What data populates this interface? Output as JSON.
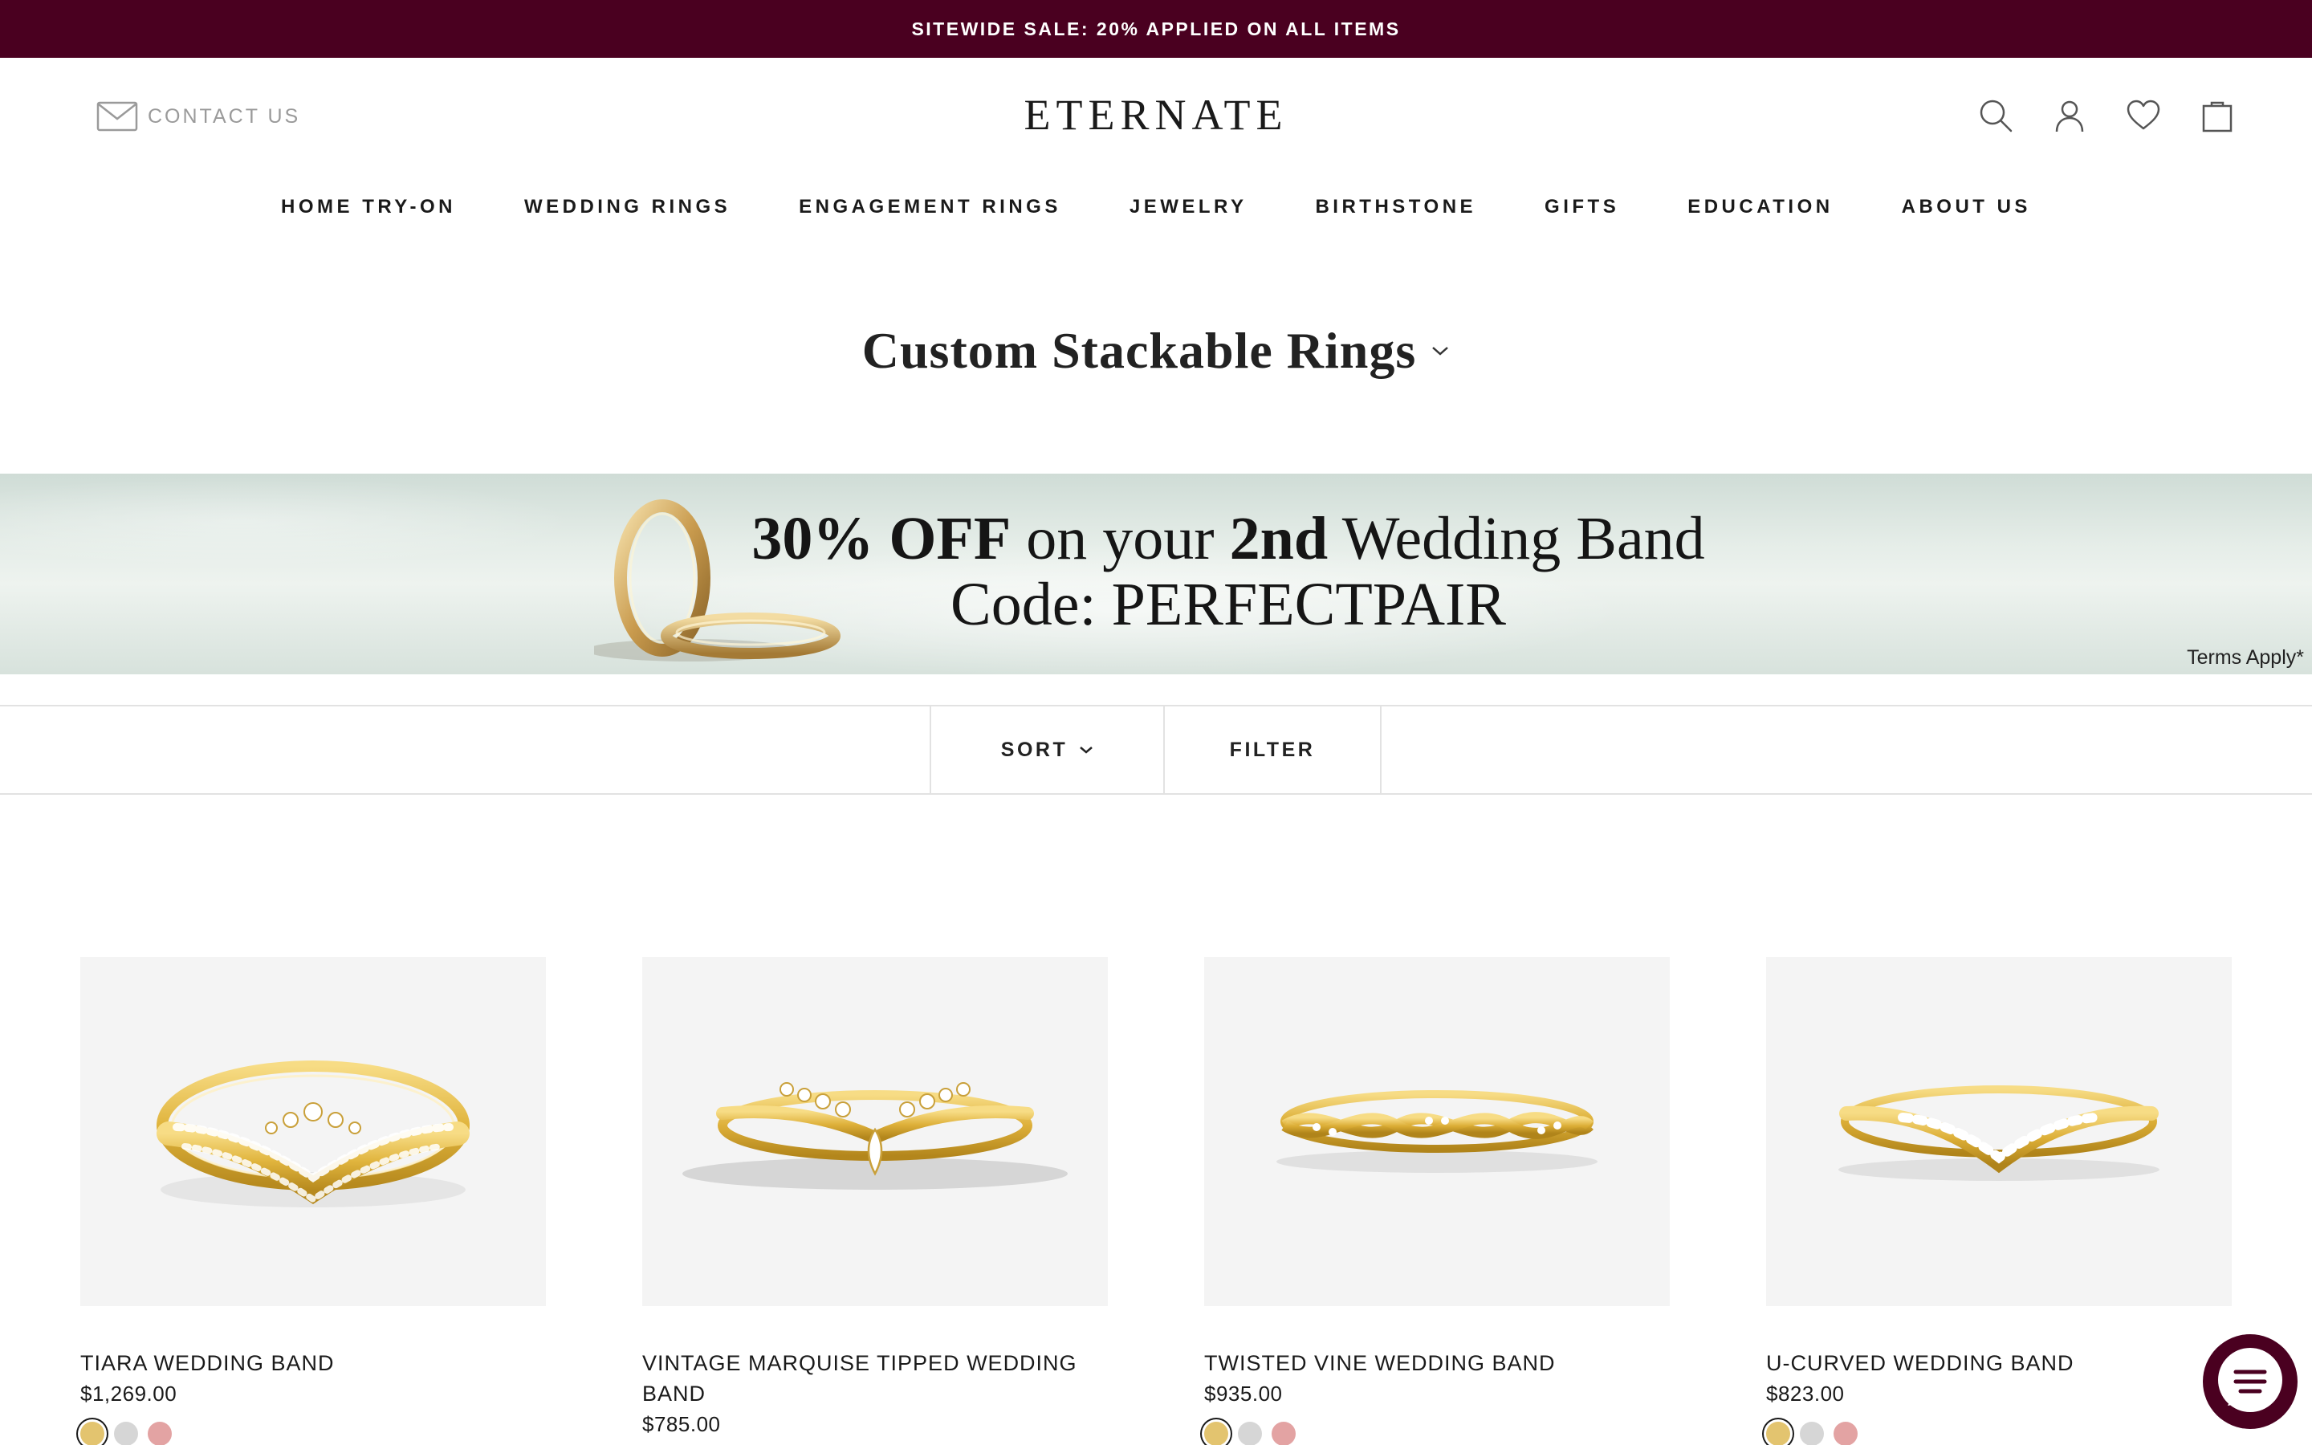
{
  "promo": {
    "text": "SITEWIDE SALE: 20% APPLIED ON ALL ITEMS"
  },
  "header": {
    "contact_label": "CONTACT US",
    "logo": "ETERNATE",
    "icons": [
      "search-icon",
      "account-icon",
      "wishlist-icon",
      "cart-icon"
    ]
  },
  "nav": {
    "items": [
      {
        "label": "HOME TRY-ON"
      },
      {
        "label": "WEDDING RINGS"
      },
      {
        "label": "ENGAGEMENT RINGS"
      },
      {
        "label": "JEWELRY"
      },
      {
        "label": "BIRTHSTONE"
      },
      {
        "label": "GIFTS"
      },
      {
        "label": "EDUCATION"
      },
      {
        "label": "ABOUT US"
      }
    ]
  },
  "page": {
    "title": "Custom Stackable Rings"
  },
  "banner": {
    "pct": "30% OFF",
    "mid": " on your ",
    "ordinal": "2nd",
    "tail": " Wedding Band",
    "code_line": "Code: PERFECTPAIR",
    "terms": "Terms Apply*"
  },
  "toolbar": {
    "sort_label": "SORT",
    "filter_label": "FILTER"
  },
  "products": [
    {
      "name": "TIARA WEDDING BAND",
      "price": "$1,269.00"
    },
    {
      "name": "VINTAGE MARQUISE TIPPED WEDDING BAND",
      "price": "$785.00"
    },
    {
      "name": "TWISTED VINE WEDDING BAND",
      "price": "$935.00"
    },
    {
      "name": "U-CURVED WEDDING BAND",
      "price": "$823.00"
    }
  ],
  "metal_swatches": [
    {
      "name": "yellow-gold",
      "color": "#e3c46f"
    },
    {
      "name": "white-gold",
      "color": "#d6d6d6"
    },
    {
      "name": "rose-gold",
      "color": "#e3a3a3"
    }
  ],
  "colors": {
    "accent": "#4a0020",
    "image_bg": "#f4f4f4"
  }
}
